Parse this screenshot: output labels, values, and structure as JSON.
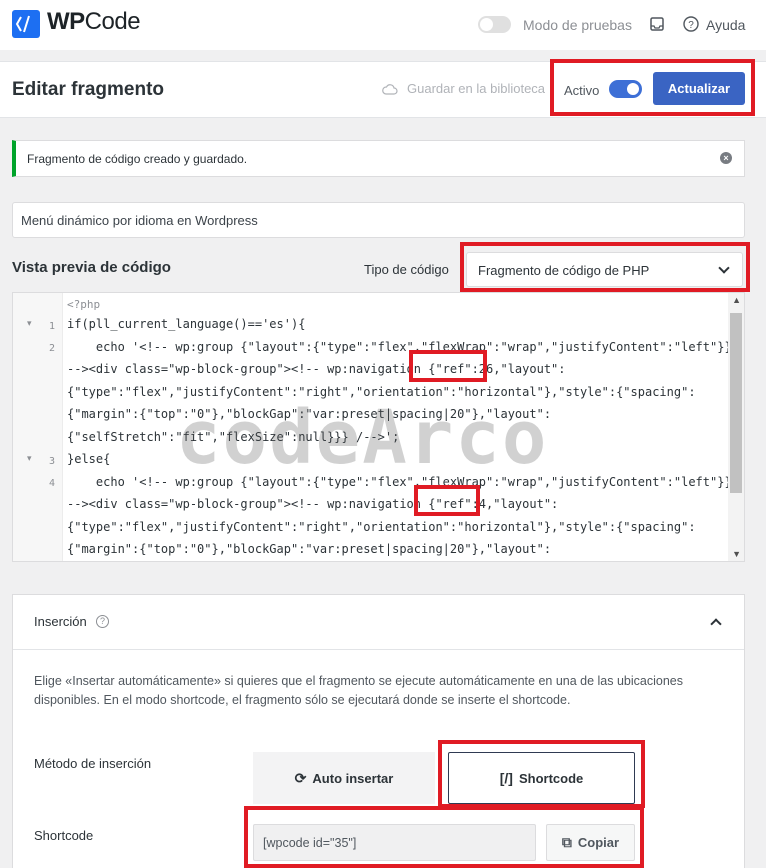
{
  "brand": {
    "name_bold": "WP",
    "name_thin": "Code"
  },
  "topbar": {
    "test_mode_label": "Modo de pruebas",
    "help_label": "Ayuda"
  },
  "header": {
    "title": "Editar fragmento",
    "save_library": "Guardar en la biblioteca",
    "active_label": "Activo",
    "update_button": "Actualizar"
  },
  "notice": {
    "text": "Fragmento de código creado y guardado."
  },
  "snippet": {
    "title": "Menú dinámico por idioma en Wordpress"
  },
  "preview": {
    "label": "Vista previa de código",
    "code_type_label": "Tipo de código",
    "code_type_value": "Fragmento de código de PHP"
  },
  "code_lines": [
    "<?php",
    "if(pll_current_language()=='es'){",
    "    echo '<!-- wp:group {\"layout\":{\"type\":\"flex\",\"flexWrap\":\"wrap\",\"justifyContent\":\"left\"}}",
    "--><div class=\"wp-block-group\"><!-- wp:navigation {\"ref\":26,\"layout\":",
    "{\"type\":\"flex\",\"justifyContent\":\"right\",\"orientation\":\"horizontal\"},\"style\":{\"spacing\":",
    "{\"margin\":{\"top\":\"0\"},\"blockGap\":\"var:preset|spacing|20\"},\"layout\":",
    "{\"selfStretch\":\"fit\",\"flexSize\":null}}} /-->';",
    "}else{",
    "    echo '<!-- wp:group {\"layout\":{\"type\":\"flex\",\"flexWrap\":\"wrap\",\"justifyContent\":\"left\"}}",
    "--><div class=\"wp-block-group\"><!-- wp:navigation {\"ref\":4,\"layout\":",
    "{\"type\":\"flex\",\"justifyContent\":\"right\",\"orientation\":\"horizontal\"},\"style\":{\"spacing\":",
    "{\"margin\":{\"top\":\"0\"},\"blockGap\":\"var:preset|spacing|20\"},\"layout\":"
  ],
  "line_numbers": [
    "1",
    "2",
    "3",
    "4"
  ],
  "watermark": "codeArco",
  "insertion": {
    "title": "Inserción",
    "description": "Elige «Insertar automáticamente» si quieres que el fragmento se ejecute automáticamente en una de las ubicaciones disponibles. En el modo shortcode, el fragmento sólo se ejecutará donde se inserte el shortcode.",
    "method_label": "Método de inserción",
    "auto_button": "Auto insertar",
    "shortcode_button": "Shortcode",
    "shortcode_label": "Shortcode",
    "shortcode_value": "[wpcode id=\"35\"]",
    "copy_button": "Copiar"
  },
  "colors": {
    "accent": "#3a64c3",
    "annotation": "#e01b24",
    "success": "#00a32a",
    "logo": "#1d6ff2"
  }
}
